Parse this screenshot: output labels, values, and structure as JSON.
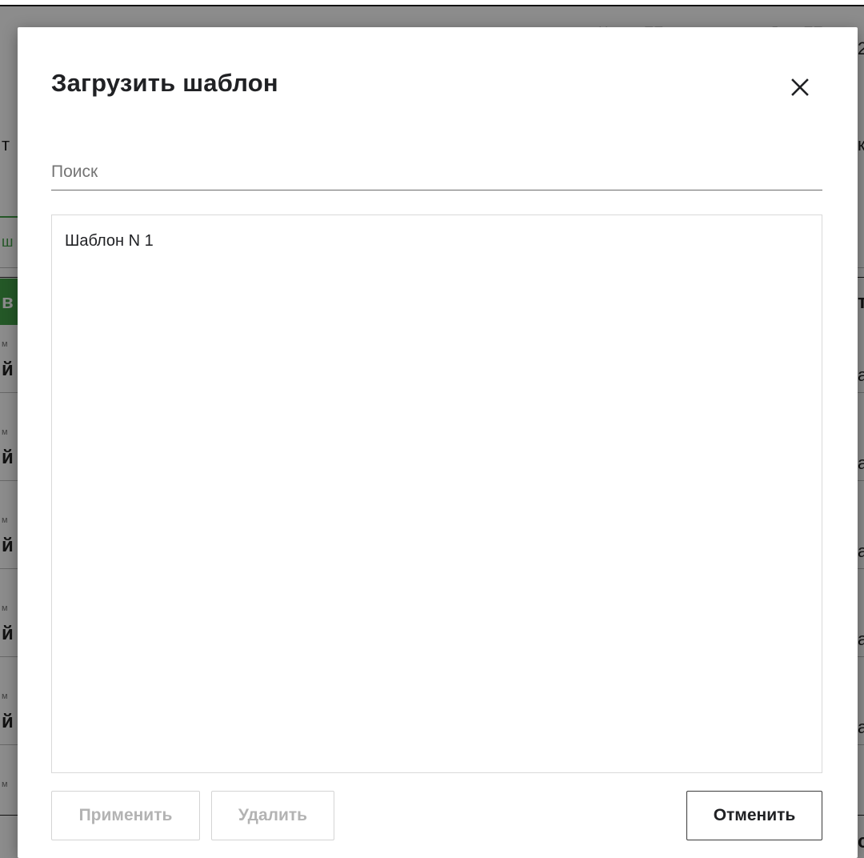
{
  "background": {
    "column_headers": [
      "Номер ПП",
      "Дата ПП"
    ],
    "edge_chars_left": [
      "т",
      "ш",
      "в",
      "м",
      "й",
      "м",
      "й",
      "м",
      "й",
      "м",
      "й",
      "м",
      "й",
      "м"
    ],
    "edge_chars_right": [
      "2",
      "к",
      "т",
      "а",
      "а",
      "а",
      "а",
      "а",
      "с"
    ]
  },
  "modal": {
    "title": "Загрузить шаблон",
    "close_icon": "close-icon",
    "search": {
      "placeholder": "Поиск",
      "value": ""
    },
    "templates": [
      {
        "label": "Шаблон N 1"
      }
    ],
    "buttons": {
      "apply_label": "Применить",
      "delete_label": "Удалить",
      "cancel_label": "Отменить"
    }
  },
  "colors": {
    "accent_green": "#43a047",
    "overlay": "rgba(0,0,0,0.45)",
    "disabled_text": "#b3b3b3"
  }
}
